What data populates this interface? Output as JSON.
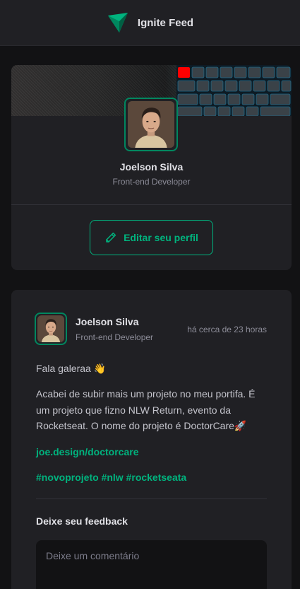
{
  "header": {
    "title": "Ignite Feed",
    "logo_icon": "ignite-triangle-logo",
    "accent": "#00b37e"
  },
  "profile": {
    "name": "Joelson Silva",
    "role": "Front-end Developer",
    "edit_label": "Editar seu perfil",
    "edit_icon": "pencil-icon"
  },
  "post": {
    "author": {
      "name": "Joelson Silva",
      "role": "Front-end Developer"
    },
    "time": "há cerca de 23 horas",
    "greeting": "Fala galeraa 👋",
    "body": "Acabei de subir mais um projeto no meu portifa. É um projeto que fizno NLW Return, evento da Rocketseat. O nome do projeto é DoctorCare🚀",
    "link": "joe.design/doctorcare",
    "tags": [
      "#novoprojeto",
      "#nlw",
      "#rocketseata"
    ],
    "feedback_title": "Deixe seu feedback",
    "comment_placeholder": "Deixe um comentário"
  },
  "colors": {
    "brand": "#00875f",
    "brand_light": "#00b37e",
    "surface": "#202024",
    "background": "#121214"
  }
}
